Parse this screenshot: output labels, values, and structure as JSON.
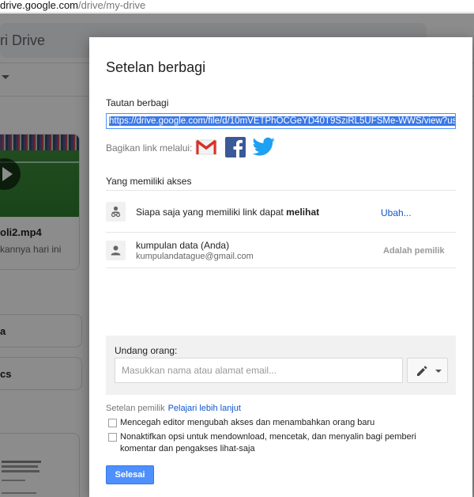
{
  "browser": {
    "url_prefix": "drive.google.com",
    "url_path": "/drive/my-drive"
  },
  "background": {
    "title": "ri Drive",
    "file_name": "oli2.mp4",
    "file_sub": "kannya hari ini",
    "pill1": "a",
    "pill2": "cs"
  },
  "dialog": {
    "title": "Setelan berbagi",
    "share_link_label": "Tautan berbagi",
    "share_link_value": "https://drive.google.com/file/d/10mVETPhOCGeYD40T9SziRL5UFSMe-WWS/view?us",
    "share_via_label": "Bagikan link melalui:",
    "share_icons": [
      "gmail-icon",
      "facebook-icon",
      "twitter-icon"
    ],
    "access_label": "Yang memiliki akses",
    "access_rows": [
      {
        "text_prefix": "Siapa saja yang memiliki link dapat ",
        "text_bold": "melihat",
        "action": "Ubah..."
      },
      {
        "name": "kumpulan data (Anda)",
        "email": "kumpulandatague@gmail.com",
        "role": "Adalah pemilik"
      }
    ],
    "invite_label": "Undang orang:",
    "invite_placeholder": "Masukkan nama atau alamat email...",
    "owner_settings_label": "Setelan pemilik",
    "learn_more": "Pelajari lebih lanjut",
    "options": [
      {
        "label": "Mencegah editor mengubah akses dan menambahkan orang baru",
        "checked": false
      },
      {
        "label": "Nonaktifkan opsi untuk mendownload, mencetak, dan menyalin bagi pemberi komentar dan pengakses lihat-saja",
        "checked": false
      }
    ],
    "done_label": "Selesai"
  },
  "colors": {
    "primary_button": "#4d90fe",
    "link": "#1155cc",
    "facebook": "#3b5998",
    "twitter": "#1da1f2",
    "gmail": "#d93025"
  }
}
